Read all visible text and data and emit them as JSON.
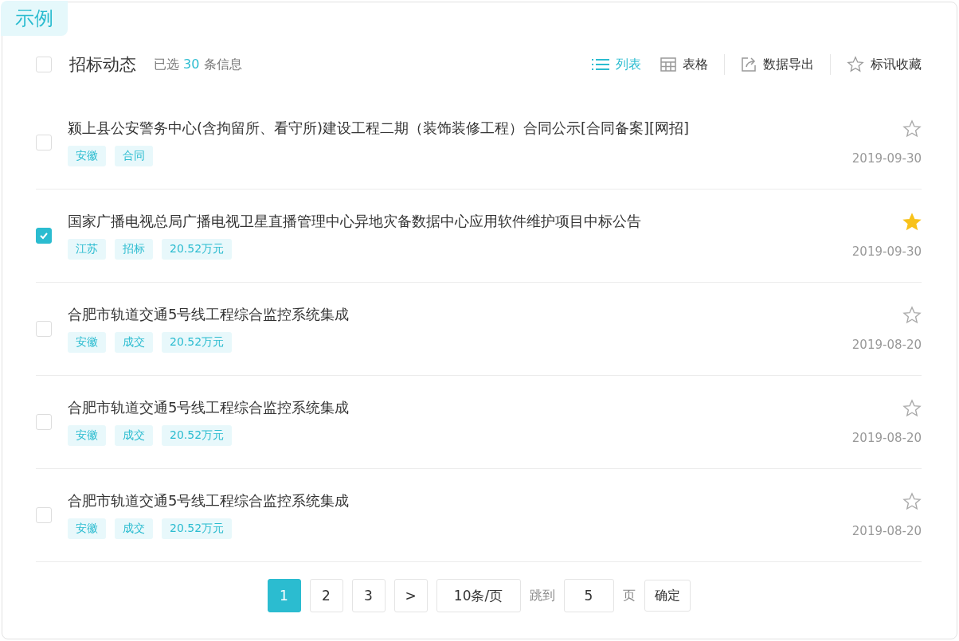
{
  "badge": "示例",
  "header": {
    "checked": false,
    "title": "招标动态",
    "selected_prefix": "已选",
    "selected_count": "30",
    "selected_suffix": "条信息"
  },
  "toolbar": [
    {
      "kind": "view",
      "label": "列表",
      "selected": true
    },
    {
      "kind": "view",
      "label": "表格",
      "selected": false
    },
    {
      "kind": "action",
      "label": "数据导出"
    },
    {
      "kind": "action",
      "label": "标讯收藏"
    }
  ],
  "rows": [
    {
      "checked": false,
      "starred": false,
      "title": "颍上县公安警务中心(含拘留所、看守所)建设工程二期（装饰装修工程）合同公示[合同备案][网招]",
      "tags": [
        "安徽",
        "合同"
      ],
      "date": "2019-09-30"
    },
    {
      "checked": true,
      "starred": true,
      "title": "国家广播电视总局广播电视卫星直播管理中心异地灾备数据中心应用软件维护项目中标公告",
      "tags": [
        "江苏",
        "招标",
        "20.52万元"
      ],
      "date": "2019-09-30"
    },
    {
      "checked": false,
      "starred": false,
      "title": "合肥市轨道交通5号线工程综合监控系统集成",
      "tags": [
        "安徽",
        "成交",
        "20.52万元"
      ],
      "date": "2019-08-20"
    },
    {
      "checked": false,
      "starred": false,
      "title": "合肥市轨道交通5号线工程综合监控系统集成",
      "tags": [
        "安徽",
        "成交",
        "20.52万元"
      ],
      "date": "2019-08-20"
    },
    {
      "checked": false,
      "starred": false,
      "title": "合肥市轨道交通5号线工程综合监控系统集成",
      "tags": [
        "安徽",
        "成交",
        "20.52万元"
      ],
      "date": "2019-08-20"
    }
  ],
  "pagination": {
    "pages": [
      {
        "label": "1",
        "selected": true
      },
      {
        "label": "2",
        "selected": false
      },
      {
        "label": "3",
        "selected": false
      }
    ],
    "next": ">",
    "page_size": "10条/页",
    "jump_label": "跳到",
    "jump_value": "5",
    "page_unit": "页",
    "confirm": "确定"
  }
}
